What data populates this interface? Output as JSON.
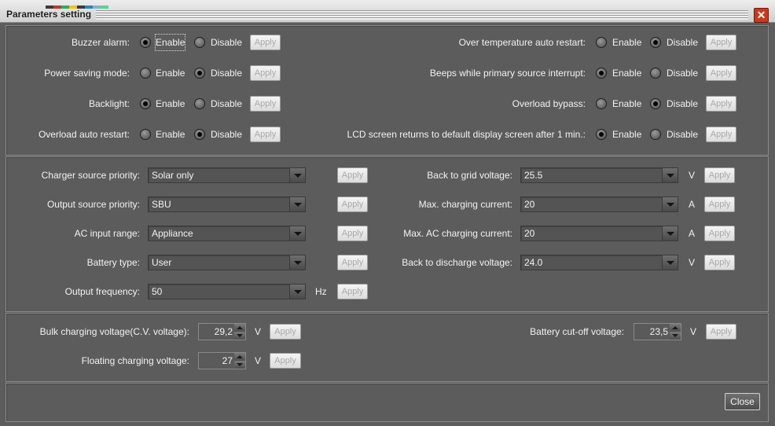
{
  "window": {
    "title": "Parameters setting"
  },
  "colors": {
    "title_bar": "#e0e0e0",
    "body": "#5c5c5c",
    "close_x": "#c93a1c"
  },
  "icons": {
    "close": "close-icon",
    "dropdown": "chevron-down-icon",
    "spinner": "spinner-arrows-icon"
  },
  "radio_options": {
    "enable": "Enable",
    "disable": "Disable"
  },
  "apply": "Apply",
  "radios": {
    "buzzer": {
      "label": "Buzzer alarm:",
      "selected": "Enable"
    },
    "power_saving": {
      "label": "Power saving mode:",
      "selected": "Disable"
    },
    "backlight": {
      "label": "Backlight:",
      "selected": "Enable"
    },
    "overload_restart": {
      "label": "Overload auto restart:",
      "selected": "Disable"
    },
    "overtemp_restart": {
      "label": "Over temperature auto restart:",
      "selected": "Disable"
    },
    "beeps": {
      "label": "Beeps while primary source interrupt:",
      "selected": "Enable"
    },
    "overload_bypass": {
      "label": "Overload bypass:",
      "selected": "Disable"
    },
    "lcd_return": {
      "label": "LCD screen returns to default display screen after 1 min.:",
      "selected": "Enable"
    }
  },
  "selects": {
    "charger_priority": {
      "label": "Charger source priority:",
      "value": "Solar only"
    },
    "output_priority": {
      "label": "Output source priority:",
      "value": "SBU"
    },
    "ac_range": {
      "label": "AC input range:",
      "value": "Appliance"
    },
    "battery_type": {
      "label": "Battery type:",
      "value": "User"
    },
    "output_freq": {
      "label": "Output frequency:",
      "value": "50",
      "unit": "Hz"
    },
    "back_grid": {
      "label": "Back to grid voltage:",
      "value": "25.5",
      "unit": "V"
    },
    "max_charge": {
      "label": "Max. charging current:",
      "value": "20",
      "unit": "A"
    },
    "max_ac_charge": {
      "label": "Max. AC charging current:",
      "value": "20",
      "unit": "A"
    },
    "back_discharge": {
      "label": "Back to discharge voltage:",
      "value": "24.0",
      "unit": "V"
    }
  },
  "spinners": {
    "bulk": {
      "label": "Bulk charging voltage(C.V. voltage):",
      "value": "29,2",
      "unit": "V"
    },
    "floating": {
      "label": "Floating charging voltage:",
      "value": "27",
      "unit": "V"
    },
    "cutoff": {
      "label": "Battery cut-off voltage:",
      "value": "23,5",
      "unit": "V"
    }
  },
  "footer": {
    "close_label": "Close"
  }
}
